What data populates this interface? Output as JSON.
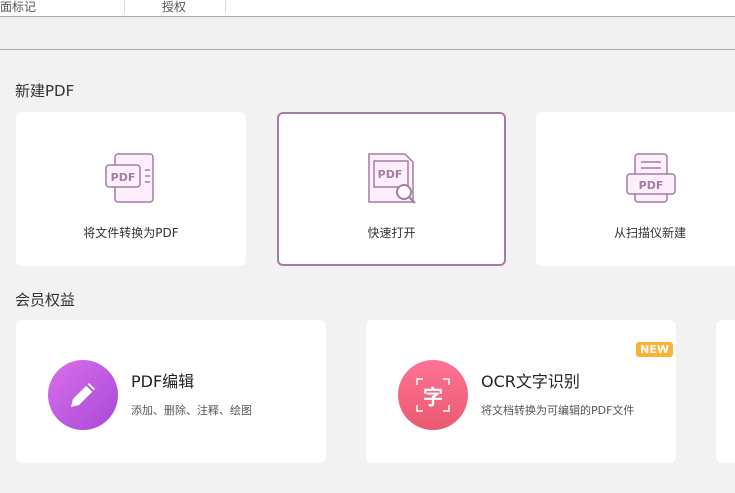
{
  "topbar": {
    "tabs": [
      "面标记",
      "授权"
    ]
  },
  "new_pdf": {
    "heading": "新建PDF",
    "cards": [
      {
        "label": "将文件转换为PDF",
        "icon": "pdf-convert-icon"
      },
      {
        "label": "快速打开",
        "icon": "pdf-search-icon"
      },
      {
        "label": "从扫描仪新建",
        "icon": "pdf-scanner-icon"
      }
    ]
  },
  "member": {
    "heading": "会员权益",
    "cards": [
      {
        "title": "PDF编辑",
        "subtitle": "添加、删除、注释、绘图",
        "icon": "pencil-icon",
        "color": "#c060e0"
      },
      {
        "title": "OCR文字识别",
        "subtitle": "将文档转换为可编辑的PDF文件",
        "icon": "ocr-char-icon",
        "icon_text": "字",
        "badge": "NEW",
        "color": "#f0607a"
      }
    ]
  },
  "icon_text": "PDF",
  "colors": {
    "accent": "#a57ca5",
    "badge": "#f9b233"
  }
}
